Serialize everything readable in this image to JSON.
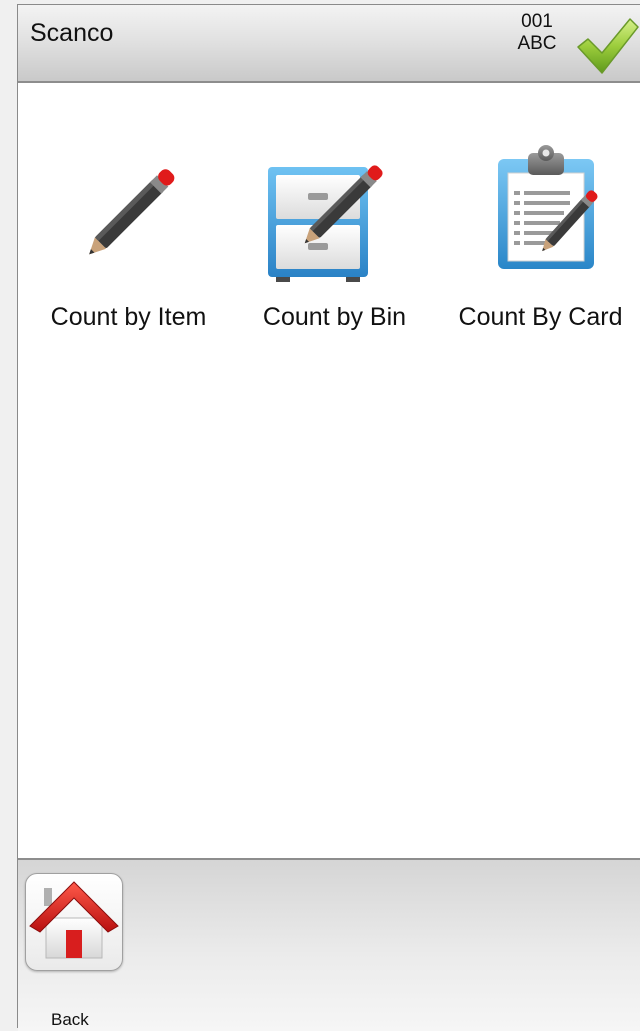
{
  "header": {
    "title": "Scanco",
    "context_line1": "001",
    "context_line2": "ABC",
    "confirm_icon": "checkmark-icon"
  },
  "menu": {
    "items": [
      {
        "label": "Count by Item",
        "icon": "pencil-icon"
      },
      {
        "label": "Count by Bin",
        "icon": "file-cabinet-pencil-icon"
      },
      {
        "label": "Count By Card",
        "icon": "clipboard-pencil-icon"
      }
    ]
  },
  "footer": {
    "back_label": "Back",
    "back_icon": "home-icon"
  },
  "colors": {
    "accent_green": "#8cc63f",
    "home_red": "#d81e1e",
    "cabinet_blue": "#3a9ad9",
    "pencil_tip_red": "#e01b1b"
  }
}
